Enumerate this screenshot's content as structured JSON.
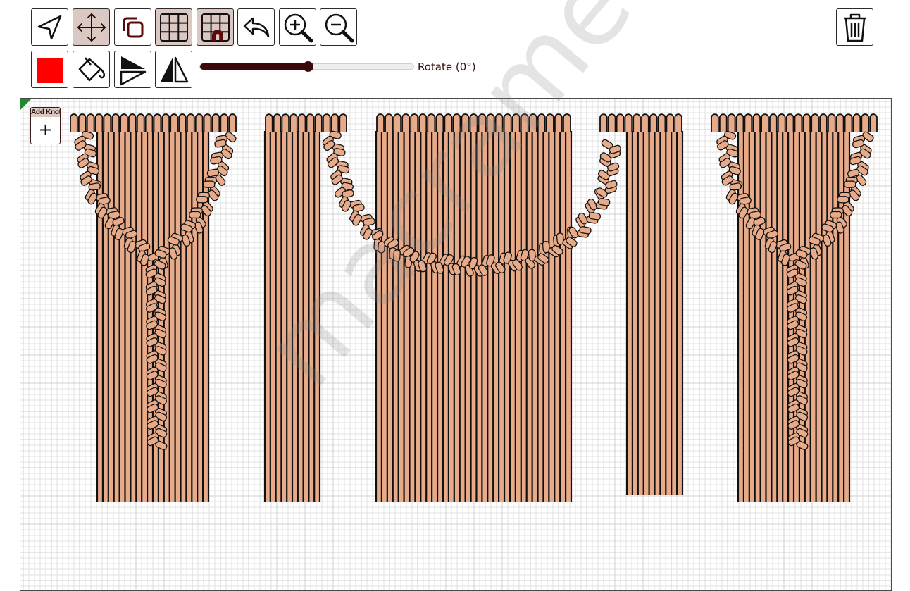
{
  "toolbar": {
    "row1": [
      {
        "name": "select-tool-button",
        "icon": "cursor-arrow-icon",
        "active": false
      },
      {
        "name": "move-tool-button",
        "icon": "move-arrows-icon",
        "active": true
      },
      {
        "name": "duplicate-button",
        "icon": "copy-icon",
        "active": false
      },
      {
        "name": "grid-toggle-button",
        "icon": "grid-icon",
        "active": true
      },
      {
        "name": "grid-snap-button",
        "icon": "grid-magnet-icon",
        "active": true
      },
      {
        "name": "undo-button",
        "icon": "undo-arrow-icon",
        "active": false
      },
      {
        "name": "zoom-in-button",
        "icon": "zoom-in-icon",
        "active": false
      },
      {
        "name": "zoom-out-button",
        "icon": "zoom-out-icon",
        "active": false
      }
    ],
    "row2": [
      {
        "name": "color-picker-button",
        "icon": "color-swatch-icon",
        "active": false
      },
      {
        "name": "paint-bucket-button",
        "icon": "paint-bucket-icon",
        "active": false
      },
      {
        "name": "flip-vertical-button",
        "icon": "flip-vertical-icon",
        "active": false
      },
      {
        "name": "flip-horizontal-button",
        "icon": "flip-horizontal-icon",
        "active": false
      }
    ],
    "delete_icon": "trash-icon",
    "swatch_color": "#ff0000",
    "rotate_label": "Rotate (0°)",
    "rotate_value": 0,
    "slider_fraction": 0.5
  },
  "canvas": {
    "add_knot_label": "Add Knot",
    "add_knot_symbol": "+",
    "watermark": "macrameter.com",
    "cord_color": "#e8ab8a",
    "outline_color": "#111111"
  }
}
